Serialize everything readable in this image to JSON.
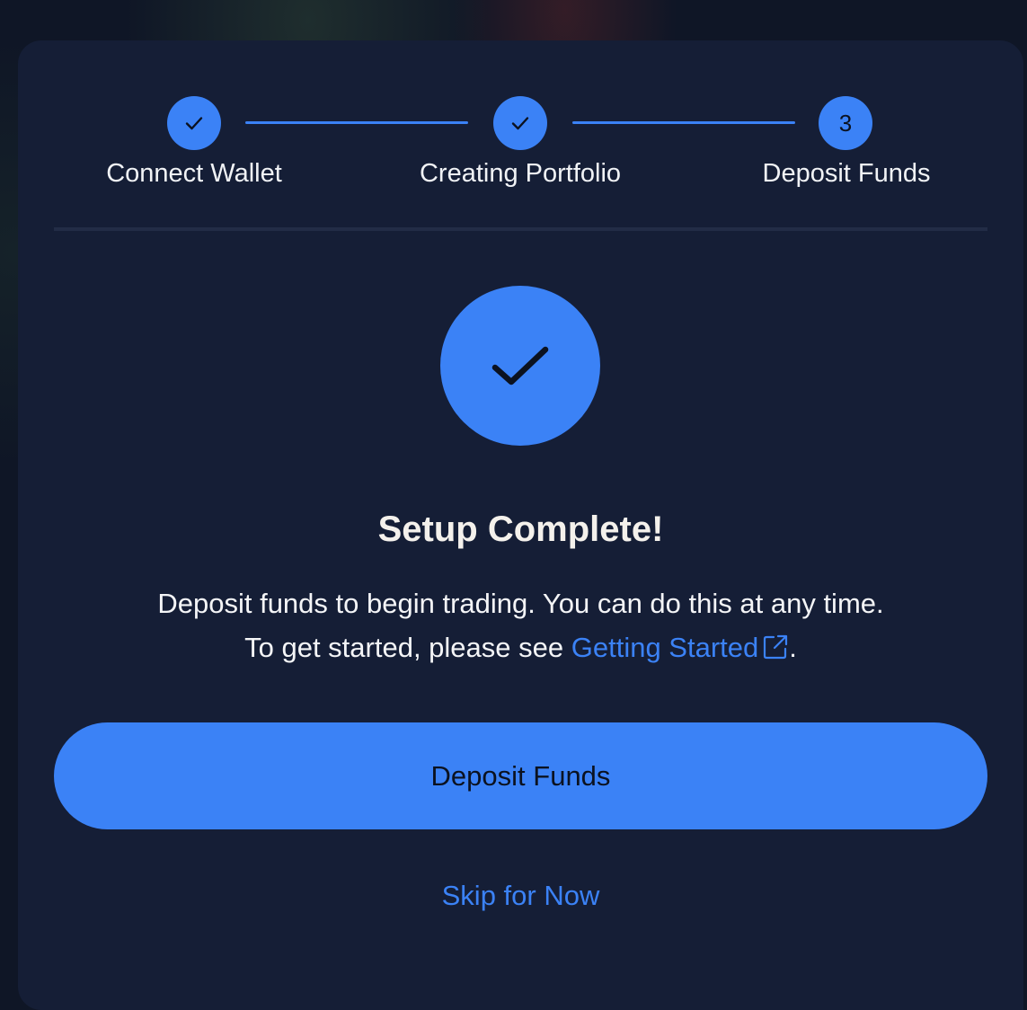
{
  "stepper": {
    "steps": [
      {
        "label": "Connect Wallet",
        "state": "complete",
        "indicator": "check-icon"
      },
      {
        "label": "Creating Portfolio",
        "state": "complete",
        "indicator": "check-icon"
      },
      {
        "label": "Deposit Funds",
        "state": "current",
        "number": "3"
      }
    ]
  },
  "success": {
    "icon": "check-icon",
    "title": "Setup Complete!",
    "line1": "Deposit funds to begin trading. You can do this at any time.",
    "line2_prefix": "To get started, please see",
    "link_label": "Getting Started",
    "link_icon": "external-link-icon",
    "line2_suffix": "."
  },
  "actions": {
    "primary_label": "Deposit Funds",
    "secondary_label": "Skip for Now"
  },
  "colors": {
    "accent": "#3b82f6",
    "modal_bg": "#151e36",
    "text": "#f4f5f7"
  }
}
